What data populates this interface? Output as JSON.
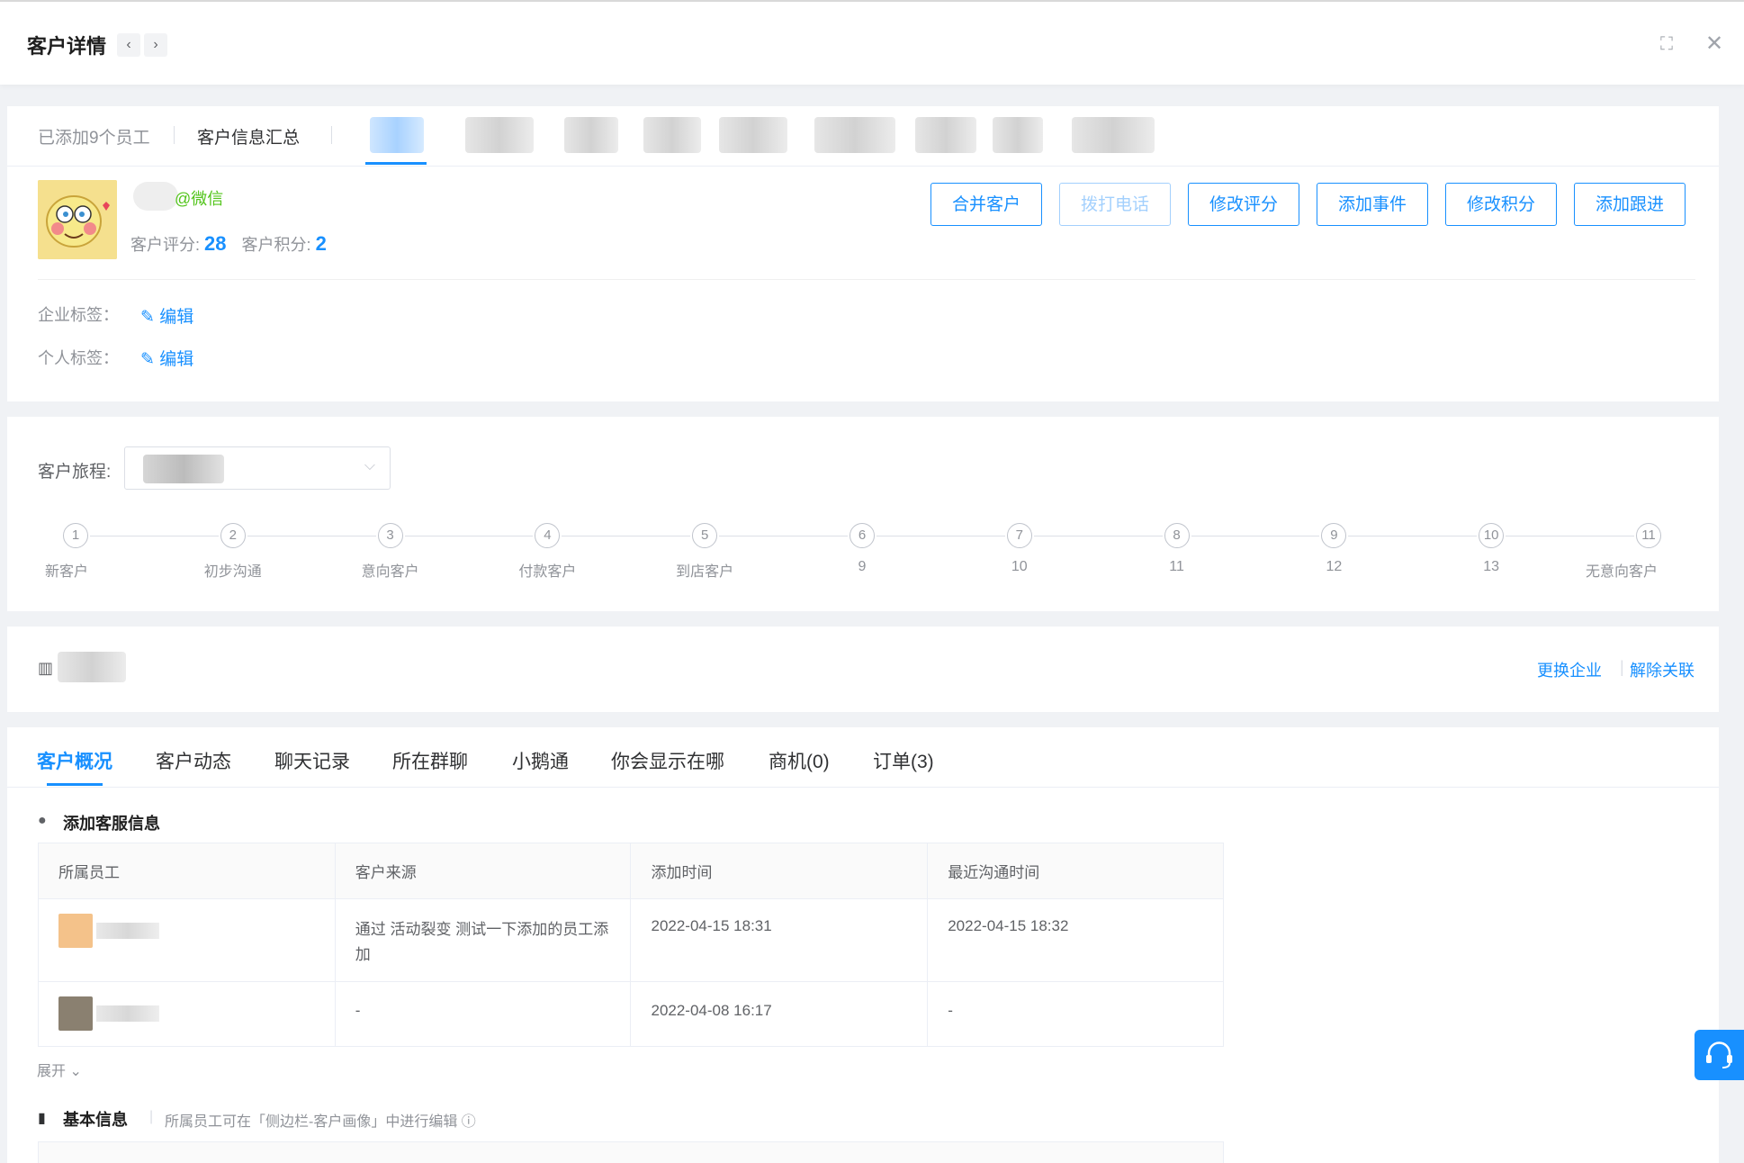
{
  "header": {
    "title": "客户详情",
    "prev": "‹",
    "next": "›",
    "icons": [
      "expand-icon",
      "close-icon"
    ]
  },
  "summary_tabs": {
    "added_staff": "已添加9个员工",
    "info_summary": "客户信息汇总"
  },
  "profile": {
    "wechat_suffix": "@微信",
    "score_label": "客户评分:",
    "score": "28",
    "points_label": "客户积分:",
    "points": "2"
  },
  "actions": [
    "合并客户",
    "拨打电话",
    "修改评分",
    "添加事件",
    "修改积分",
    "添加跟进"
  ],
  "tags": {
    "company_label": "企业标签：",
    "personal_label": "个人标签：",
    "edit": "编辑"
  },
  "journey": {
    "label": "客户旅程:",
    "steps": [
      {
        "n": "1",
        "label": "新客户"
      },
      {
        "n": "2",
        "label": "初步沟通"
      },
      {
        "n": "3",
        "label": "意向客户"
      },
      {
        "n": "4",
        "label": "付款客户"
      },
      {
        "n": "5",
        "label": "到店客户"
      },
      {
        "n": "6",
        "label": "9"
      },
      {
        "n": "7",
        "label": "10"
      },
      {
        "n": "8",
        "label": "11"
      },
      {
        "n": "9",
        "label": "12"
      },
      {
        "n": "10",
        "label": "13"
      },
      {
        "n": "11",
        "label": "无意向客户"
      }
    ]
  },
  "company": {
    "change": "更换企业",
    "unlink": "解除关联"
  },
  "main_tabs": [
    "客户概况",
    "客户动态",
    "聊天记录",
    "所在群聊",
    "小鹅通",
    "你会显示在哪",
    "商机(0)",
    "订单(3)"
  ],
  "service_info": {
    "title": "添加客服信息",
    "columns": [
      "所属员工",
      "客户来源",
      "添加时间",
      "最近沟通时间"
    ],
    "rows": [
      {
        "source": "通过 活动裂变 测试一下添加的员工添加",
        "added": "2022-04-15 18:31",
        "last": "2022-04-15 18:32"
      },
      {
        "source": "-",
        "added": "2022-04-08 16:17",
        "last": "-"
      }
    ],
    "expand": "展开"
  },
  "basic_info": {
    "title": "基本信息",
    "hint": "所属员工可在「侧边栏-客户画像」中进行编辑"
  },
  "colors": {
    "accent": "#1890ff",
    "wechat": "#52c41a"
  }
}
